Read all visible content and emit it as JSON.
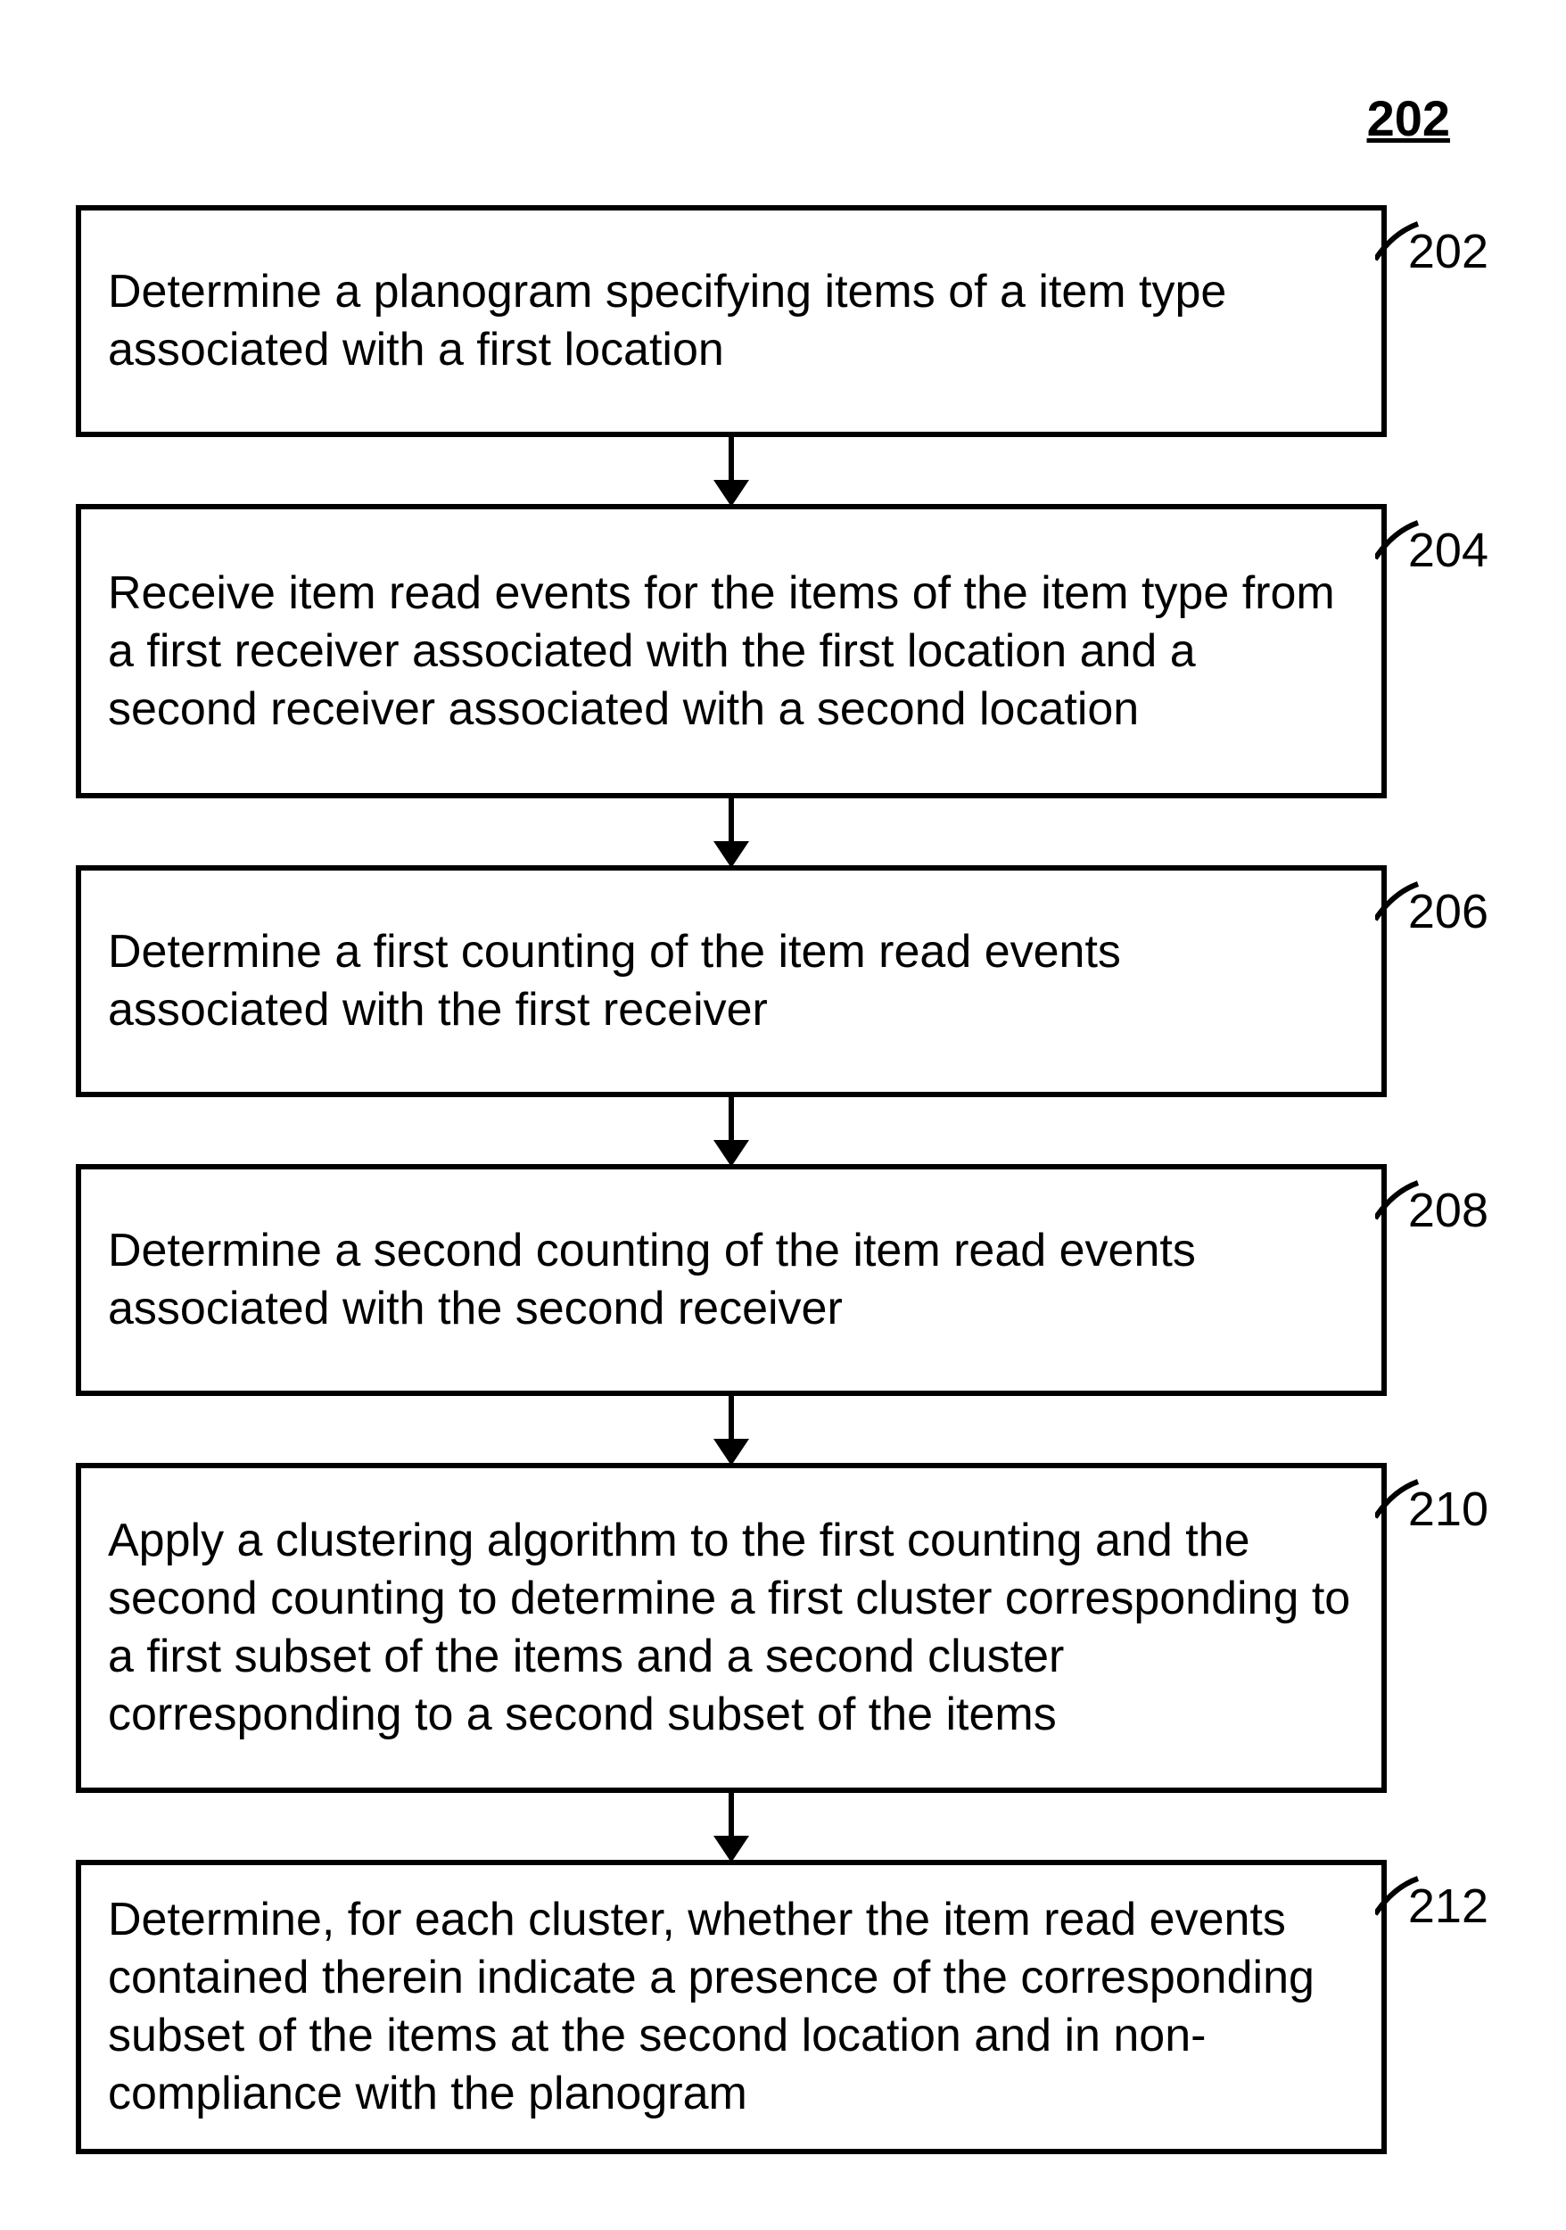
{
  "diagram": {
    "title": "202",
    "steps": [
      {
        "id": "202",
        "text": "Determine a planogram specifying items of a item type associated with a first location"
      },
      {
        "id": "204",
        "text": "Receive item read events for the items of the item type from a first receiver associated with the first location and a second receiver associated with a second location"
      },
      {
        "id": "206",
        "text": "Determine a first counting of the item read events associated with the first receiver"
      },
      {
        "id": "208",
        "text": "Determine a second counting of the item read events associated with the second receiver"
      },
      {
        "id": "210",
        "text": "Apply a clustering algorithm to the first counting and the second counting to determine a first cluster corresponding to a first subset of the items and a second cluster corresponding to a second subset of the items"
      },
      {
        "id": "212",
        "text": "Determine, for each cluster, whether the item read events contained therein indicate a presence of the corresponding subset of the items at the second location and in non-compliance with the planogram"
      }
    ]
  }
}
